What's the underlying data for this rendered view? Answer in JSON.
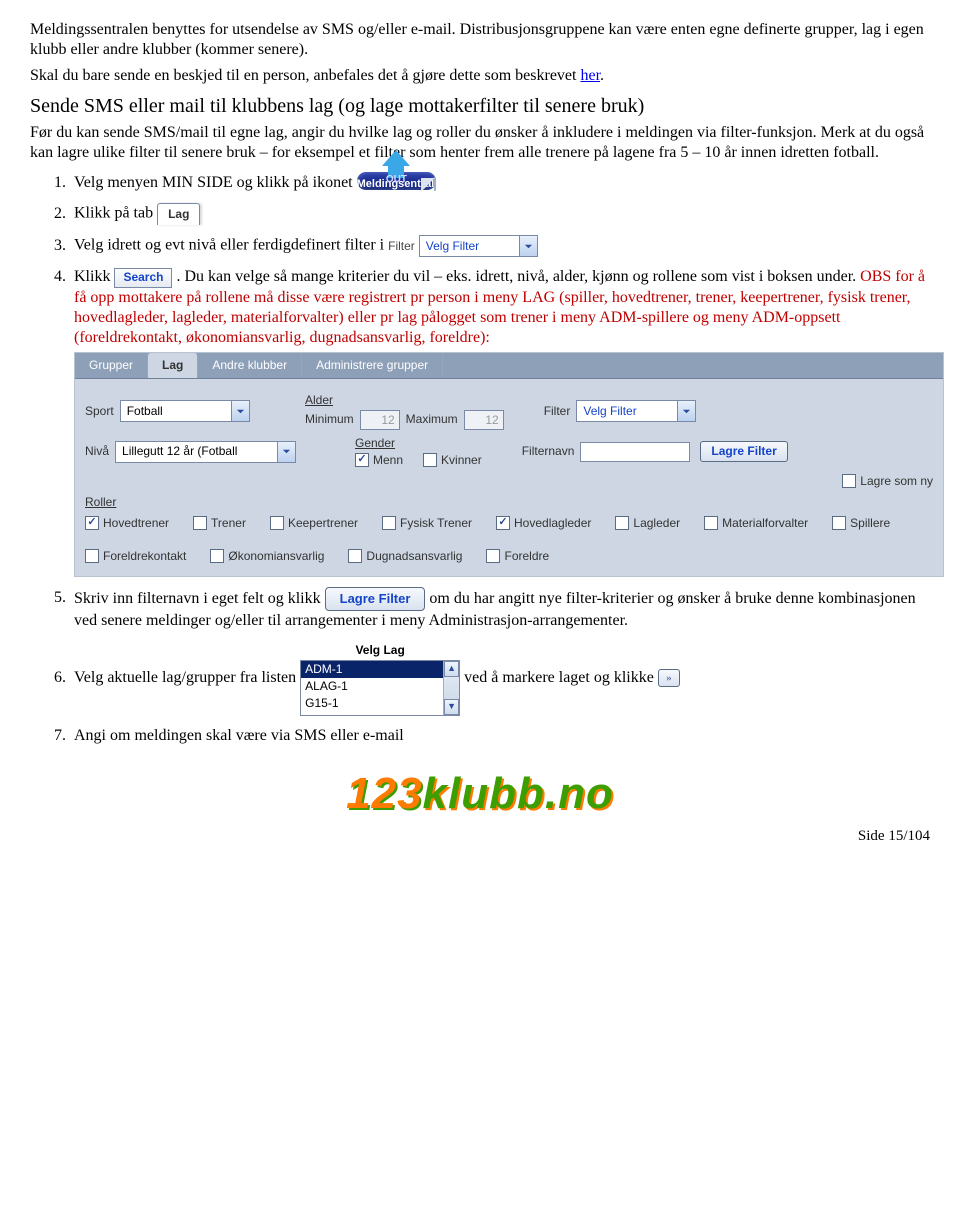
{
  "intro": {
    "p1": "Meldingssentralen benyttes for utsendelse av SMS og/eller e-mail. Distribusjonsgruppene kan være enten egne definerte grupper, lag i egen klubb eller andre klubber (kommer senere).",
    "p2a": "Skal du bare sende en beskjed til en person, anbefales det å gjøre dette som beskrevet ",
    "p2_link": "her",
    "p2b": "."
  },
  "subhead": "Sende SMS eller mail til klubbens lag (og lage mottakerfilter til senere bruk)",
  "lead": "Før du kan sende SMS/mail til egne lag, angir du hvilke lag og roller du ønsker å inkludere i meldingen via filter-funksjon. Merk at du også kan lagre ulike filter til senere bruk – for eksempel et filter som henter frem alle trenere på lagene fra 5 – 10 år innen idretten fotball.",
  "tile_melding": {
    "title": "Meldingsentral",
    "out": "OUT"
  },
  "steps": {
    "s1": "Velg menyen MIN SIDE og klikk på ikonet ",
    "s2": "Klikk på tab ",
    "s2_tab": "Lag",
    "s3": "Velg idrett og evt nivå eller ferdigdefinert filter i ",
    "s3_filter_label": "Filter",
    "s3_filter_value": "Velg Filter",
    "s4a": "Klikk ",
    "s4_btn": "Search",
    "s4b": ". Du kan velge så mange kriterier du vil – eks. idrett, nivå, alder, kjønn og rollene som vist i boksen under. ",
    "s4_red": "OBS for å få opp mottakere på rollene må disse være registrert pr person i meny LAG (spiller, hovedtrener, trener, keepertrener, fysisk trener, hovedlagleder, lagleder, materialforvalter) eller pr lag pålogget som trener i meny ADM-spillere og meny ADM-oppsett (foreldrekontakt, økonomiansvarlig, dugnadsansvarlig, foreldre):",
    "s5a": "Skriv inn filternavn i eget felt og klikk ",
    "s5_btn": "Lagre Filter",
    "s5b": " om du har angitt nye filter-kriterier og ønsker å bruke denne kombinasjonen ved senere meldinger og/eller til arrangementer i meny Administrasjon-arrangementer.",
    "s6a": "Velg aktuelle lag/grupper fra listen ",
    "s6b": " ved å markere laget og klikke ",
    "s7": "Angi om meldingen skal være via SMS eller e-mail"
  },
  "panel": {
    "tabs": [
      "Grupper",
      "Lag",
      "Andre klubber",
      "Administrere grupper"
    ],
    "active_tab_index": 1,
    "sport_label": "Sport",
    "sport_value": "Fotball",
    "alder_label": "Alder",
    "min_label": "Minimum",
    "min_value": "12",
    "max_label": "Maximum",
    "max_value": "12",
    "filter_label": "Filter",
    "filter_value": "Velg Filter",
    "niva_label": "Nivå",
    "niva_value": "Lillegutt 12 år (Fotball ",
    "gender_label": "Gender",
    "gender_menn": "Menn",
    "gender_kvinner": "Kvinner",
    "filternavn_label": "Filternavn",
    "lagre_filter_btn": "Lagre Filter",
    "lagre_som_ny": "Lagre som ny",
    "roller_label": "Roller",
    "roles": [
      "Hovedtrener",
      "Trener",
      "Keepertrener",
      "Fysisk Trener",
      "Hovedlagleder",
      "Lagleder",
      "Materialforvalter",
      "Spillere",
      "Foreldrekontakt",
      "Økonomiansvarlig",
      "Dugnadsansvarlig",
      "Foreldre"
    ],
    "roles_checked_index": [
      0,
      4
    ]
  },
  "velg_lag": {
    "title": "Velg Lag",
    "items": [
      "ADM-1",
      "ALAG-1",
      "G15-1"
    ],
    "selected_index": 0
  },
  "logo": {
    "p1": "123",
    "p2": "klubb.no"
  },
  "page_number": "Side 15/104"
}
